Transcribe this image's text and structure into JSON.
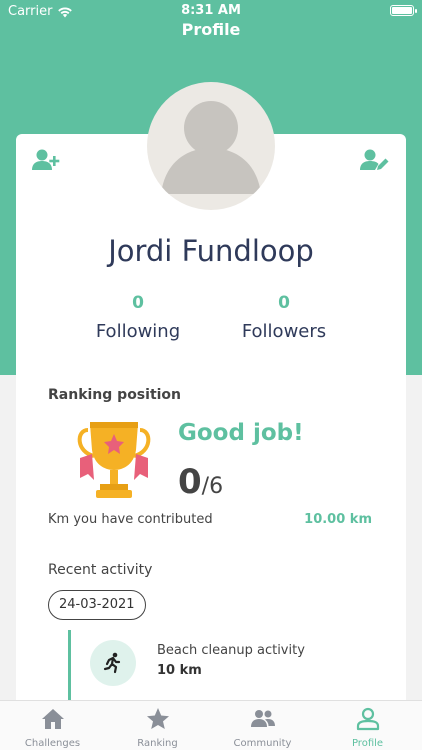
{
  "status_bar": {
    "carrier": "Carrier",
    "time": "8:31 AM"
  },
  "nav": {
    "title": "Profile"
  },
  "profile": {
    "name": "Jordi Fundloop"
  },
  "stats": {
    "following_count": "0",
    "following_label": "Following",
    "followers_count": "0",
    "followers_label": "Followers"
  },
  "ranking": {
    "title": "Ranking position",
    "message": "Good job!",
    "position": "0",
    "total": "/6"
  },
  "contribution": {
    "label": "Km you have contributed",
    "value": "10.00 km"
  },
  "recent": {
    "title": "Recent activity",
    "date": "24-03-2021",
    "activity": {
      "title": "Beach cleanup activity",
      "distance": "10 km"
    }
  },
  "tabs": [
    {
      "label": "Challenges",
      "icon": "home-icon"
    },
    {
      "label": "Ranking",
      "icon": "star-icon"
    },
    {
      "label": "Community",
      "icon": "people-icon"
    },
    {
      "label": "Profile",
      "icon": "user-icon",
      "active": true
    }
  ],
  "colors": {
    "accent": "#5ec0a0",
    "text_dark": "#2f3a5a",
    "tab_inactive": "#8a8f98"
  }
}
